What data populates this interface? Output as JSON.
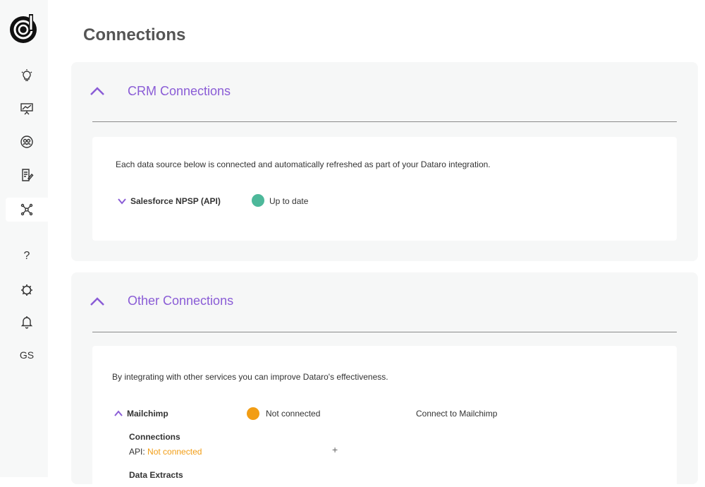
{
  "sidebar": {
    "logo_icon": "dataro-logo-icon",
    "items": [
      {
        "name": "insights",
        "icon": "lightbulb-icon"
      },
      {
        "name": "reports",
        "icon": "presentation-chart-icon"
      },
      {
        "name": "audience",
        "icon": "users-circle-icon"
      },
      {
        "name": "campaigns",
        "icon": "document-edit-icon"
      },
      {
        "name": "connections",
        "icon": "network-nodes-icon",
        "active": true
      },
      {
        "name": "help",
        "label": "?"
      },
      {
        "name": "settings",
        "icon": "gear-icon"
      },
      {
        "name": "notifications",
        "icon": "bell-icon"
      },
      {
        "name": "account",
        "label": "GS"
      }
    ]
  },
  "page": {
    "title": "Connections"
  },
  "crm": {
    "title": "CRM Connections",
    "description": "Each data source below is connected and automatically refreshed as part of your Dataro integration.",
    "sources": [
      {
        "name": "Salesforce NPSP (API)",
        "status": "Up to date",
        "status_color": "#4db89a"
      }
    ]
  },
  "other": {
    "title": "Other Connections",
    "description": "By integrating with other services you can improve Dataro's effectiveness.",
    "sources": [
      {
        "name": "Mailchimp",
        "status": "Not connected",
        "status_color": "#f29d14",
        "connect_label": "Connect to Mailchimp",
        "connections_heading": "Connections",
        "api_label": "API:",
        "api_status": "Not connected",
        "add_label": "+",
        "extracts_heading": "Data Extracts"
      }
    ]
  },
  "colors": {
    "accent": "#8a5cd6",
    "success": "#4db89a",
    "warning": "#f29d14"
  }
}
